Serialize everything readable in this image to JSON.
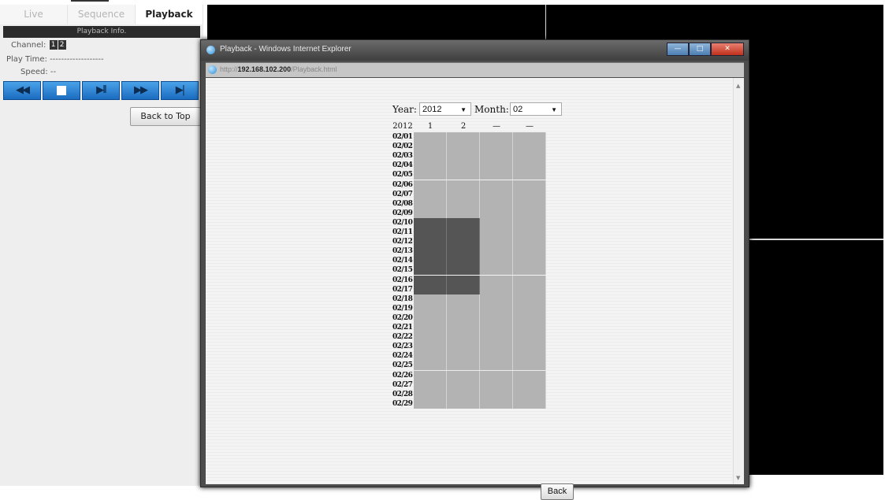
{
  "tabs": [
    {
      "label": "Live",
      "active": false
    },
    {
      "label": "Sequence",
      "active": false
    },
    {
      "label": "Playback",
      "active": true
    }
  ],
  "left_panel": {
    "info_header": "Playback Info.",
    "channel_label": "Channel:",
    "channels": [
      "1",
      "2"
    ],
    "play_time_label": "Play Time:",
    "play_time_value": "-------------------",
    "speed_label": "Speed:",
    "speed_value": "--",
    "controls": [
      {
        "name": "rewind-button",
        "icon": "rewind-icon",
        "glyph": "◀◀"
      },
      {
        "name": "stop-button",
        "icon": "stop-icon",
        "glyph": ""
      },
      {
        "name": "play-pause-button",
        "icon": "play-pause-icon",
        "glyph": "▶II"
      },
      {
        "name": "fast-forward-button",
        "icon": "fast-forward-icon",
        "glyph": "▶▶"
      },
      {
        "name": "step-forward-button",
        "icon": "step-forward-icon",
        "glyph": "▶|"
      }
    ],
    "back_to_top_label": "Back to Top"
  },
  "popup": {
    "title": "Playback - Windows Internet Explorer",
    "url_prefix": "http://",
    "url_host": "192.168.102.200",
    "url_path": "/Playback.html",
    "year_label": "Year:",
    "year_value": "2012",
    "month_label": "Month:",
    "month_value": "02",
    "grid_header": [
      "2012",
      "1",
      "2",
      "—",
      "—"
    ],
    "dates": [
      "02/01",
      "02/02",
      "02/03",
      "02/04",
      "02/05",
      "02/06",
      "02/07",
      "02/08",
      "02/09",
      "02/10",
      "02/11",
      "02/12",
      "02/13",
      "02/14",
      "02/15",
      "02/16",
      "02/17",
      "02/18",
      "02/19",
      "02/20",
      "02/21",
      "02/22",
      "02/23",
      "02/24",
      "02/25",
      "02/26",
      "02/27",
      "02/28",
      "02/29"
    ],
    "recorded_dates": [
      "02/10",
      "02/11",
      "02/12",
      "02/13",
      "02/14",
      "02/15",
      "02/16",
      "02/17"
    ],
    "recorded_channels": [
      1,
      2
    ],
    "back_label": "Back"
  },
  "colors": {
    "recorded_cell": "#555555",
    "empty_cell": "#b3b3b3",
    "control_button": "#1b6cc0"
  }
}
